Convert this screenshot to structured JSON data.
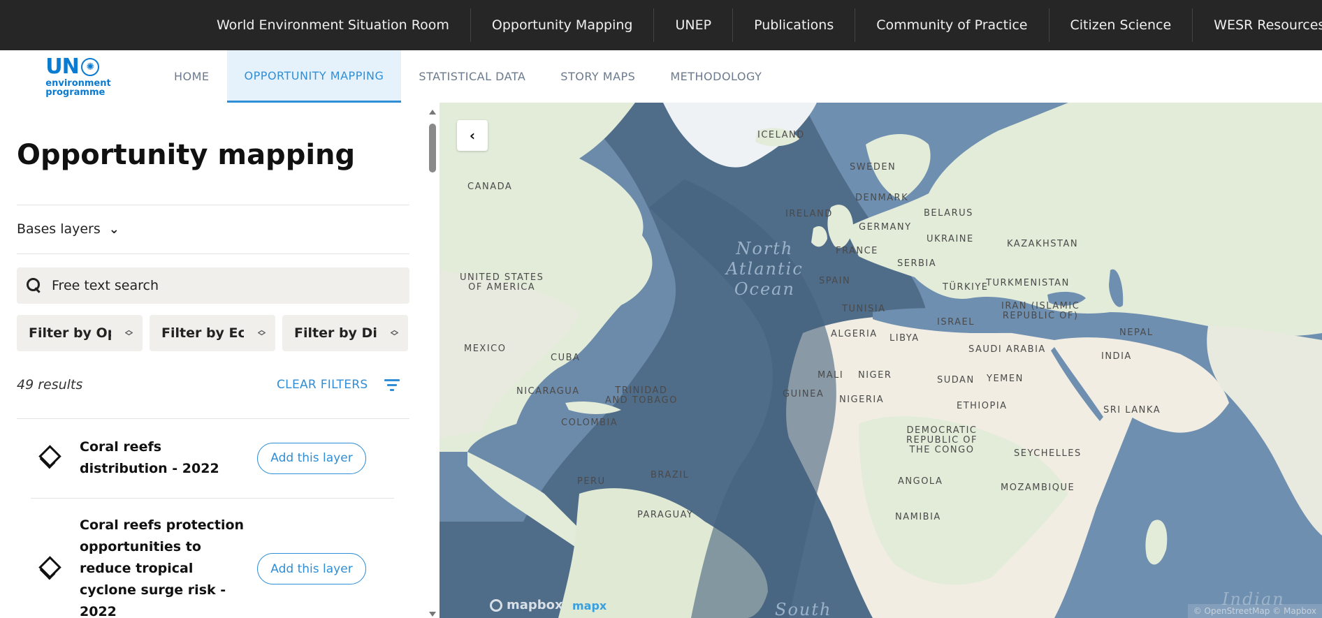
{
  "topnav": {
    "items": [
      "World Environment Situation Room",
      "Opportunity Mapping",
      "UNEP",
      "Publications",
      "Community of Practice",
      "Citizen Science",
      "WESR Resources"
    ]
  },
  "logo": {
    "top": "UN",
    "line1": "environment",
    "line2": "programme"
  },
  "tabs": [
    {
      "label": "HOME",
      "active": false
    },
    {
      "label": "OPPORTUNITY MAPPING",
      "active": true
    },
    {
      "label": "STATISTICAL DATA",
      "active": false
    },
    {
      "label": "STORY MAPS",
      "active": false
    },
    {
      "label": "METHODOLOGY",
      "active": false
    }
  ],
  "panel": {
    "title": "Opportunity mapping",
    "bases_label": "Bases layers",
    "search_placeholder": "Free text search",
    "filters": [
      "Filter by Opportunity",
      "Filter by Ecosystem",
      "Filter by Disaster"
    ],
    "results_count": "49 results",
    "clear_filters": "CLEAR FILTERS",
    "layers": [
      {
        "title": "Coral reefs distribution - 2022",
        "button": "Add this layer"
      },
      {
        "title": "Coral reefs protection opportunities to reduce tropical cyclone surge risk - 2022",
        "button": "Add this layer"
      }
    ]
  },
  "map": {
    "labels": [
      {
        "text": "ICELAND"
      },
      {
        "text": "SWEDEN"
      },
      {
        "text": "CANADA"
      },
      {
        "text": "DENMARK"
      },
      {
        "text": "IRELAND"
      },
      {
        "text": "BELARUS"
      },
      {
        "text": "GERMANY"
      },
      {
        "text": "UKRAINE"
      },
      {
        "text": "KAZAKHSTAN"
      },
      {
        "text": "FRANCE"
      },
      {
        "text": "SERBIA"
      },
      {
        "text": "UNITED STATES\nOF AMERICA"
      },
      {
        "text": "SPAIN"
      },
      {
        "text": "TÜRKIYE"
      },
      {
        "text": "TURKMENISTAN"
      },
      {
        "text": "TUNISIA"
      },
      {
        "text": "IRAN (ISLAMIC\nREPUBLIC OF)"
      },
      {
        "text": "ISRAEL"
      },
      {
        "text": "ALGERIA"
      },
      {
        "text": "LIBYA"
      },
      {
        "text": "NEPAL"
      },
      {
        "text": "MEXICO"
      },
      {
        "text": "SAUDI ARABIA"
      },
      {
        "text": "INDIA"
      },
      {
        "text": "CUBA"
      },
      {
        "text": "MALI"
      },
      {
        "text": "NIGER"
      },
      {
        "text": "SUDAN"
      },
      {
        "text": "YEMEN"
      },
      {
        "text": "NICARAGUA"
      },
      {
        "text": "TRINIDAD\nAND TOBAGO"
      },
      {
        "text": "GUINEA"
      },
      {
        "text": "NIGERIA"
      },
      {
        "text": "ETHIOPIA"
      },
      {
        "text": "SRI LANKA"
      },
      {
        "text": "COLOMBIA"
      },
      {
        "text": "DEMOCRATIC\nREPUBLIC OF\nTHE CONGO"
      },
      {
        "text": "SEYCHELLES"
      },
      {
        "text": "PERU"
      },
      {
        "text": "BRAZIL"
      },
      {
        "text": "ANGOLA"
      },
      {
        "text": "MOZAMBIQUE"
      },
      {
        "text": "PARAGUAY"
      },
      {
        "text": "NAMIBIA"
      }
    ],
    "ocean_labels": [
      {
        "text": "North\nAtlantic\nOcean"
      },
      {
        "text": "South"
      },
      {
        "text": "Indian"
      }
    ],
    "collapse_icon": "chevron-left-icon",
    "mapbox": "mapbox",
    "mapx": "mapx",
    "attribution": "© OpenStreetMap © Mapbox"
  }
}
